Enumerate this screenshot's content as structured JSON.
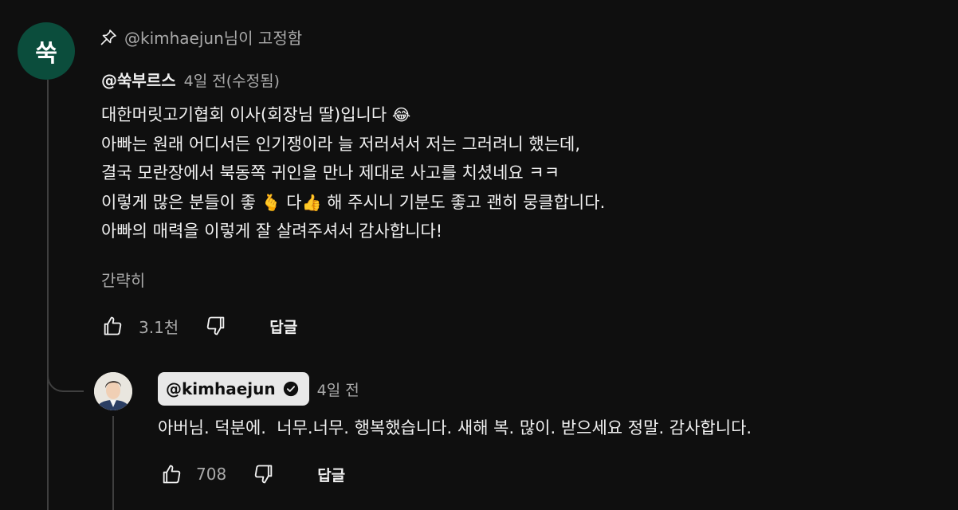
{
  "comment": {
    "avatar_text": "쑥",
    "pinned_text": "@kimhaejun님이 고정함",
    "author": "@쑥부르스",
    "time": "4일 전(수정됨)",
    "lines": {
      "l1": "대한머릿고기협회 이사(회장님 딸)입니다 ",
      "l1_emoji": "😂",
      "l2": "아빠는 원래 어디서든 인기쟁이라 늘 저러셔서 저는 그러려니 했는데,",
      "l3": "결국 모란장에서 북동쪽 귀인을 만나 제대로 사고를 치셨네요 ㅋㅋ",
      "l4a": "이렇게 많은 분들이 좋 ",
      "l4_emoji1": "🫰",
      "l4b": " 다",
      "l4_emoji2": "👍",
      "l4c": " 해 주시니 기분도 좋고 괜히 뭉클합니다.",
      "l5": "아빠의 매력을 이렇게 잘 살려주셔서 감사합니다!"
    },
    "collapse_label": "간략히",
    "like_count": "3.1천",
    "reply_label": "답글"
  },
  "reply": {
    "author": "@kimhaejun",
    "time": "4일 전",
    "text": "아버님. 덕분에.  너무.너무. 행복했습니다. 새해 복. 많이. 받으세요 정말. 감사합니다.",
    "like_count": "708",
    "reply_label": "답글"
  },
  "icons": {
    "pin": "pin-icon",
    "like": "thumbs-up-icon",
    "dislike": "thumbs-down-icon",
    "verified": "verified-check-icon"
  },
  "colors": {
    "background": "#0f0f0f",
    "avatar_bg": "#0b4d3c",
    "muted_text": "#aaaaaa",
    "chip_bg": "#e8e8e8"
  }
}
